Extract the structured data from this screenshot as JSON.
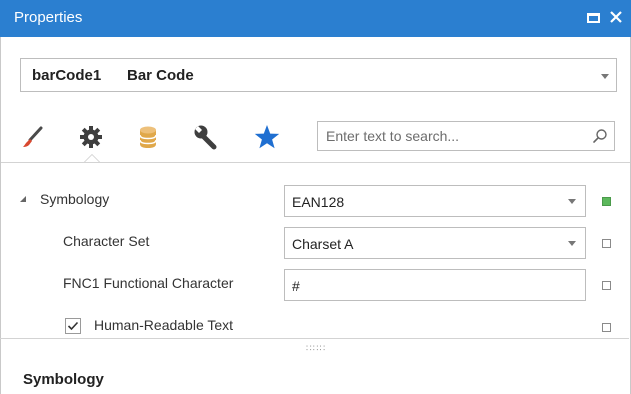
{
  "window": {
    "title": "Properties"
  },
  "object_selector": {
    "name": "barCode1",
    "type": "Bar Code"
  },
  "tabs": [
    {
      "icon": "brush-icon"
    },
    {
      "icon": "gear-icon"
    },
    {
      "icon": "database-icon"
    },
    {
      "icon": "wrench-icon"
    },
    {
      "icon": "star-icon"
    }
  ],
  "search": {
    "placeholder": "Enter text to search..."
  },
  "properties": {
    "symbology": {
      "label": "Symbology",
      "value": "EAN128",
      "modified": true
    },
    "character_set": {
      "label": "Character Set",
      "value": "Charset A"
    },
    "fnc1": {
      "label": "FNC1 Functional Character",
      "value": "#"
    },
    "human_readable": {
      "label": "Human-Readable Text",
      "checked": true
    }
  },
  "description": {
    "title": "Symbology"
  },
  "colors": {
    "titlebar": "#2b7fd0",
    "favorite_star": "#1f6fd1",
    "database": "#e0a84a",
    "brush_tip": "#d9482f",
    "modified_marker": "#5cb85c"
  }
}
